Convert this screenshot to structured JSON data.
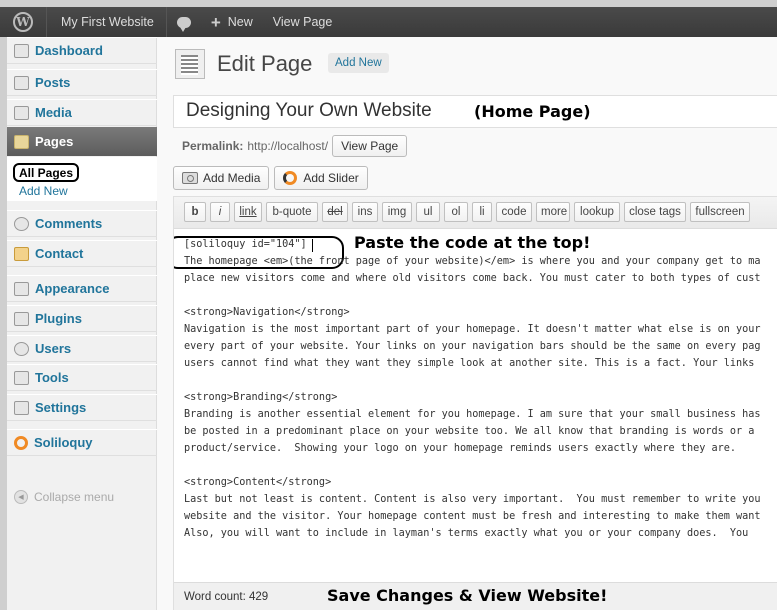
{
  "admin_bar": {
    "site_name": "My First Website",
    "new_label": "New",
    "view_page_label": "View Page"
  },
  "sidebar": {
    "dashboard": "Dashboard",
    "posts": "Posts",
    "media": "Media",
    "pages": "Pages",
    "pages_sub_all": "All Pages",
    "pages_sub_add_new": "Add New",
    "comments": "Comments",
    "contact": "Contact",
    "appearance": "Appearance",
    "plugins": "Plugins",
    "users": "Users",
    "tools": "Tools",
    "settings": "Settings",
    "soliloquy": "Soliloquy",
    "collapse": "Collapse menu"
  },
  "header": {
    "title": "Edit Page",
    "add_new": "Add New"
  },
  "post": {
    "title": "Designing Your Own Website",
    "permalink_label": "Permalink:",
    "permalink_url": "http://localhost/",
    "view_page_button": "View Page"
  },
  "media_buttons": {
    "add_media": "Add Media",
    "add_slider": "Add Slider"
  },
  "quicktags": [
    "b",
    "i",
    "link",
    "b-quote",
    "del",
    "ins",
    "img",
    "ul",
    "ol",
    "li",
    "code",
    "more",
    "lookup",
    "close tags",
    "fullscreen"
  ],
  "editor": {
    "shortcode": "[soliloquy id=\"104\"]",
    "lines": [
      "The homepage <em>(the front page of your website)</em> is where you and your company get to ma",
      "place new visitors come and where old visitors come back. You must cater to both types of cust",
      "",
      "<strong>Navigation</strong>",
      "Navigation is the most important part of your homepage. It doesn't matter what else is on your",
      "every part of your website. Your links on your navigation bars should be the same on every pag",
      "users cannot find what they want they simple look at another site. This is a fact. Your links",
      "",
      "<strong>Branding</strong>",
      "Branding is another essential element for you homepage. I am sure that your small business has",
      "be posted in a predominant place on your website too. We all know that branding is words or a",
      "product/service.  Showing your logo on your homepage reminds users exactly where they are.",
      "",
      "<strong>Content</strong>",
      "Last but not least is content. Content is also very important.  You must remember to write you",
      "website and the visitor. Your homepage content must be fresh and interesting to make them want",
      "Also, you will want to include in layman's terms exactly what you or your company does.  You"
    ],
    "word_count": "Word count: 429"
  },
  "annotations": {
    "home_page": "(Home Page)",
    "paste_code": "Paste the code at the top!",
    "save_changes": "Save Changes & View Website!"
  },
  "colors": {
    "admin_bar_bg": "#464646",
    "link_blue": "#21759b",
    "active_menu_bg": "#6d6d6d",
    "accent_orange": "#f08a24"
  }
}
